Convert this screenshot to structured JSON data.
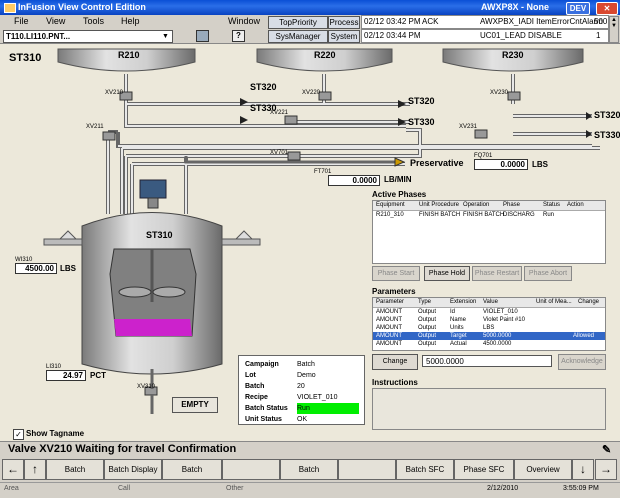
{
  "window": {
    "title": "InFusion View Control Edition",
    "right_title": "AWXP8X - None",
    "dev_label": "DEV"
  },
  "menu": {
    "items": [
      "File",
      "View",
      "Tools",
      "Help"
    ],
    "window": "Window"
  },
  "header": {
    "top_priority": "TopPriority",
    "process": "Process",
    "sys_manager": "SysManager",
    "system": "System",
    "alarms": [
      {
        "time": "02/12 03:42 PM",
        "state": "ACK",
        "text": "AWXPBX_IADI ItemErrorCntAlarm",
        "num": "500"
      },
      {
        "time": "02/12 03:44 PM",
        "state": "",
        "text": "UC01_LEAD DISABLE",
        "num": "1"
      }
    ],
    "tagname": "T110.LI110.PNT..."
  },
  "process": {
    "unit": "ST310",
    "tanks": [
      "R210",
      "R220",
      "R230"
    ],
    "valves": [
      "XV210",
      "XV220",
      "XV230",
      "XV211",
      "XV221",
      "XV231",
      "XV701",
      "XV310"
    ],
    "destinations": [
      "ST320",
      "ST330",
      "ST320",
      "ST330",
      "ST320",
      "ST330"
    ],
    "flow": {
      "tag": "FT701",
      "value": "0.0000",
      "unit": "LB/MIN"
    },
    "preservative": {
      "label": "Preservative",
      "tag": "FQ701",
      "value": "0.0000",
      "unit": "LBS"
    },
    "weight": {
      "tag": "WI310",
      "value": "4500.00",
      "unit": "LBS"
    },
    "level": {
      "tag": "LI310",
      "value": "24.97",
      "unit": "PCT"
    },
    "reactor_label": "ST310",
    "empty_button": "EMPTY",
    "show_tagname": "Show Tagname"
  },
  "batch": {
    "rows": [
      {
        "label": "Campaign",
        "value": "Batch"
      },
      {
        "label": "Lot",
        "value": "Demo"
      },
      {
        "label": "Batch",
        "value": "20"
      },
      {
        "label": "Recipe",
        "value": "VIOLET_010"
      },
      {
        "label": "Batch Status",
        "value": "Run"
      },
      {
        "label": "Unit Status",
        "value": "OK"
      }
    ],
    "status_color": "#00ee00"
  },
  "phases": {
    "title": "Active Phases",
    "headers": [
      "Equipment",
      "Unit Procedure",
      "Operation",
      "Phase",
      "Status",
      "Action"
    ],
    "rows": [
      [
        "R210_310",
        "FINISH BATCH",
        "FINISH BATCH",
        "DISCHARG",
        "Run",
        ""
      ]
    ],
    "buttons": [
      "Phase Start",
      "Phase Hold",
      "Phase Restart",
      "Phase Abort"
    ]
  },
  "parameters": {
    "title": "Parameters",
    "headers": [
      "Parameter",
      "Type",
      "Extension",
      "Value",
      "Unit of Mea...",
      "Change"
    ],
    "rows": [
      [
        "AMOUNT",
        "Output",
        "Id",
        "VIOLET_010",
        "",
        ""
      ],
      [
        "AMOUNT",
        "Output",
        "Name",
        "Violet Paint #10",
        "",
        ""
      ],
      [
        "AMOUNT",
        "Output",
        "Units",
        "LBS",
        "",
        ""
      ],
      [
        "AMOUNT",
        "Output",
        "Target",
        "5000.0000",
        "",
        "Allowed"
      ],
      [
        "AMOUNT",
        "Output",
        "Actual",
        "4500.0000",
        "",
        ""
      ]
    ],
    "selected_row": 3,
    "change_button": "Change",
    "change_value": "5000.0000",
    "ack_button": "Acknowledge"
  },
  "instructions": {
    "title": "Instructions"
  },
  "message": "Valve XV210 Waiting for travel Confirmation",
  "nav": {
    "buttons": [
      "Batch Scheduler",
      "Batch Display",
      "Batch Equipment",
      "",
      "Batch Messages",
      "",
      "Batch SFC",
      "Phase SFC",
      "Overview"
    ]
  },
  "status": {
    "left1": "Area",
    "left2": "Call",
    "left3": "Other",
    "date": "2/12/2010",
    "time": "3:55:09 PM"
  },
  "colors": {
    "accent": "#3166c6",
    "contents": "#cc22cc",
    "run": "#00ee00"
  }
}
